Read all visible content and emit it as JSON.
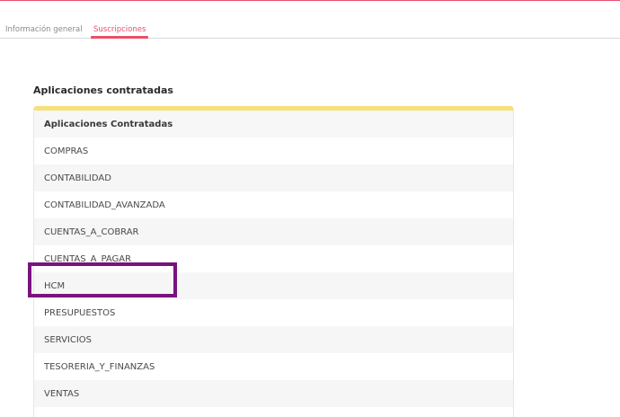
{
  "tabs": {
    "general": "Información general",
    "subscriptions": "Suscripciones"
  },
  "section": {
    "title": "Aplicaciones contratadas"
  },
  "table": {
    "header": "Aplicaciones Contratadas",
    "rows": [
      "COMPRAS",
      "CONTABILIDAD",
      "CONTABILIDAD_AVANZADA",
      "CUENTAS_A_COBRAR",
      "CUENTAS_A_PAGAR",
      "HCM",
      "PRESUPUESTOS",
      "SERVICIOS",
      "TESORERIA_Y_FINANZAS",
      "VENTAS"
    ]
  },
  "colors": {
    "accent": "#e8506a",
    "table_top_border": "#f6e07c",
    "highlight": "#7a127e"
  }
}
